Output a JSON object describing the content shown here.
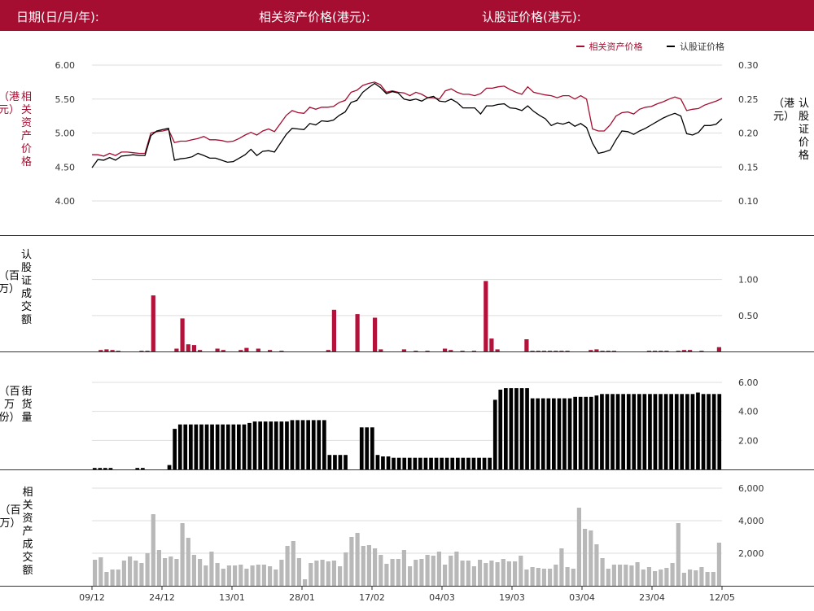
{
  "header": {
    "date_label": "日期(日/月/年):",
    "underlying_label": "相关资产价格(港元):",
    "warrant_label": "认股证价格(港元):"
  },
  "legend": {
    "underlying": "相关资产价格",
    "warrant": "认股证价格"
  },
  "axis_titles": {
    "price_left": "相关资产价格",
    "price_left_unit": "（港元）",
    "price_right": "认股证价格",
    "price_right_unit": "（港元）",
    "turnover": "认股证成交额",
    "turnover_unit": "（百万）",
    "outstanding": "街货量",
    "outstanding_unit": "（百万份）",
    "underlying_turnover": "相关资产成交额",
    "underlying_turnover_unit": "（百万）"
  },
  "colors": {
    "header_bg": "#a50d31",
    "underlying": "#a50d31",
    "warrant": "#000000",
    "turnover_bar": "#b5123b",
    "outstanding_bar": "#000000",
    "underlying_turnover_bar": "#b8b8b8"
  },
  "chart_data": [
    {
      "type": "line",
      "x_ticks": [
        "09/12",
        "24/12",
        "13/01",
        "28/01",
        "17/02",
        "04/03",
        "19/03",
        "03/04",
        "23/04",
        "12/05"
      ],
      "left_axis": {
        "ylim": [
          4.0,
          6.0
        ],
        "ticks": [
          "6.00",
          "5.50",
          "5.00",
          "4.50",
          "4.00"
        ]
      },
      "right_axis": {
        "ylim": [
          0.1,
          0.3
        ],
        "ticks": [
          "0.30",
          "0.25",
          "0.20",
          "0.15",
          "0.10"
        ]
      },
      "series": [
        {
          "name": "相关资产价格",
          "axis": "left",
          "values": [
            4.68,
            4.68,
            4.66,
            4.7,
            4.67,
            4.72,
            4.72,
            4.71,
            4.7,
            4.7,
            5.0,
            5.02,
            5.03,
            5.05,
            4.86,
            4.88,
            4.88,
            4.9,
            4.92,
            4.95,
            4.9,
            4.9,
            4.89,
            4.87,
            4.88,
            4.92,
            4.97,
            5.01,
            4.97,
            5.03,
            5.06,
            5.02,
            5.14,
            5.26,
            5.33,
            5.3,
            5.29,
            5.38,
            5.35,
            5.38,
            5.38,
            5.39,
            5.45,
            5.48,
            5.6,
            5.63,
            5.7,
            5.73,
            5.75,
            5.71,
            5.6,
            5.62,
            5.6,
            5.59,
            5.55,
            5.6,
            5.57,
            5.52,
            5.52,
            5.5,
            5.62,
            5.65,
            5.6,
            5.57,
            5.57,
            5.55,
            5.58,
            5.66,
            5.66,
            5.68,
            5.69,
            5.64,
            5.6,
            5.57,
            5.68,
            5.6,
            5.58,
            5.56,
            5.55,
            5.52,
            5.55,
            5.55,
            5.5,
            5.55,
            5.5,
            5.06,
            5.03,
            5.03,
            5.12,
            5.25,
            5.3,
            5.31,
            5.28,
            5.35,
            5.38,
            5.39,
            5.43,
            5.46,
            5.5,
            5.53,
            5.5,
            5.33,
            5.35,
            5.36,
            5.41,
            5.44,
            5.47,
            5.51
          ]
        },
        {
          "name": "认股证价格",
          "axis": "right",
          "values": [
            0.149,
            0.161,
            0.16,
            0.164,
            0.16,
            0.166,
            0.167,
            0.168,
            0.167,
            0.167,
            0.196,
            0.203,
            0.205,
            0.207,
            0.16,
            0.162,
            0.163,
            0.165,
            0.17,
            0.167,
            0.163,
            0.163,
            0.16,
            0.157,
            0.158,
            0.163,
            0.168,
            0.176,
            0.167,
            0.173,
            0.174,
            0.172,
            0.185,
            0.198,
            0.207,
            0.206,
            0.205,
            0.214,
            0.212,
            0.218,
            0.217,
            0.219,
            0.226,
            0.231,
            0.245,
            0.248,
            0.26,
            0.267,
            0.273,
            0.267,
            0.258,
            0.261,
            0.259,
            0.25,
            0.248,
            0.25,
            0.247,
            0.252,
            0.254,
            0.247,
            0.246,
            0.25,
            0.245,
            0.237,
            0.237,
            0.237,
            0.228,
            0.24,
            0.24,
            0.242,
            0.243,
            0.237,
            0.236,
            0.233,
            0.24,
            0.232,
            0.226,
            0.221,
            0.211,
            0.215,
            0.213,
            0.216,
            0.21,
            0.214,
            0.208,
            0.185,
            0.17,
            0.172,
            0.175,
            0.19,
            0.203,
            0.202,
            0.198,
            0.203,
            0.207,
            0.212,
            0.217,
            0.222,
            0.226,
            0.229,
            0.225,
            0.199,
            0.197,
            0.201,
            0.211,
            0.211,
            0.213,
            0.221
          ]
        }
      ]
    },
    {
      "type": "bar",
      "name": "认股证成交额",
      "ylim": [
        0,
        1.2
      ],
      "y_ticks": [
        "1.00",
        "0.50"
      ],
      "values": [
        0,
        0.02,
        0.03,
        0.02,
        0.01,
        0,
        0,
        0,
        0.01,
        0.01,
        0.78,
        0,
        0,
        0,
        0.04,
        0.46,
        0.1,
        0.09,
        0.02,
        0,
        0,
        0.04,
        0.02,
        0,
        0,
        0.02,
        0.05,
        0,
        0.04,
        0,
        0.02,
        0,
        0.01,
        0,
        0,
        0,
        0,
        0,
        0,
        0,
        0.02,
        0.58,
        0,
        0,
        0,
        0.52,
        0,
        0,
        0.47,
        0.03,
        0,
        0,
        0,
        0.03,
        0,
        0.01,
        0,
        0.01,
        0,
        0,
        0.04,
        0.02,
        0,
        0.01,
        0,
        0.01,
        0,
        0.98,
        0.18,
        0.03,
        0,
        0,
        0,
        0,
        0.17,
        0.01,
        0.01,
        0.01,
        0.01,
        0.01,
        0.01,
        0.01,
        0,
        0,
        0,
        0.02,
        0.03,
        0.01,
        0.01,
        0.01,
        0,
        0,
        0,
        0,
        0,
        0.01,
        0.01,
        0.01,
        0.01,
        0,
        0.01,
        0.02,
        0.02,
        0,
        0.01,
        0,
        0,
        0.06
      ]
    },
    {
      "type": "bar",
      "name": "街货量",
      "ylim": [
        0,
        6.0
      ],
      "y_ticks": [
        "6.00",
        "4.00",
        "2.00"
      ],
      "values": [
        0.1,
        0.1,
        0.1,
        0.1,
        0,
        0,
        0,
        0,
        0.1,
        0.1,
        0,
        0,
        0,
        0,
        0.3,
        2.8,
        3.1,
        3.1,
        3.1,
        3.1,
        3.1,
        3.1,
        3.1,
        3.1,
        3.1,
        3.1,
        3.1,
        3.1,
        3.1,
        3.2,
        3.3,
        3.3,
        3.3,
        3.3,
        3.3,
        3.3,
        3.3,
        3.4,
        3.4,
        3.4,
        3.4,
        3.4,
        3.4,
        3.4,
        1.0,
        1.0,
        1.0,
        1.0,
        0,
        0,
        2.9,
        2.9,
        2.9,
        1.0,
        0.9,
        0.9,
        0.8,
        0.8,
        0.8,
        0.8,
        0.8,
        0.8,
        0.8,
        0.8,
        0.8,
        0.8,
        0.8,
        0.8,
        0.8,
        0.8,
        0.8,
        0.8,
        0.8,
        0.8,
        0.8,
        4.8,
        5.5,
        5.6,
        5.6,
        5.6,
        5.6,
        5.6,
        4.9,
        4.9,
        4.9,
        4.9,
        4.9,
        4.9,
        4.9,
        4.9,
        5.0,
        5.0,
        5.0,
        5.0,
        5.1,
        5.2,
        5.2,
        5.2,
        5.2,
        5.2,
        5.2,
        5.2,
        5.2,
        5.2,
        5.2,
        5.2,
        5.2,
        5.2,
        5.2,
        5.2,
        5.2,
        5.2,
        5.2,
        5.3,
        5.2,
        5.2,
        5.2,
        5.2
      ]
    },
    {
      "type": "bar",
      "name": "相关资产成交额",
      "ylim": [
        0,
        7200
      ],
      "y_ticks": [
        "6,000",
        "4,000",
        "2,000"
      ],
      "values": [
        1600,
        1750,
        850,
        1000,
        1000,
        1550,
        1800,
        1550,
        1400,
        2000,
        4400,
        2200,
        1700,
        1800,
        1650,
        3850,
        2950,
        1900,
        1650,
        1250,
        2100,
        1400,
        1050,
        1250,
        1250,
        1300,
        1050,
        1250,
        1300,
        1300,
        1200,
        1000,
        1600,
        2450,
        2750,
        1700,
        400,
        1400,
        1550,
        1600,
        1500,
        1550,
        1200,
        2050,
        3000,
        3250,
        2450,
        2500,
        2300,
        1900,
        1350,
        1650,
        1650,
        2200,
        1200,
        1600,
        1650,
        1900,
        1850,
        2100,
        1300,
        1850,
        2100,
        1550,
        1550,
        1200,
        1600,
        1400,
        1550,
        1450,
        1650,
        1500,
        1500,
        1850,
        1000,
        1150,
        1100,
        1050,
        1050,
        1300,
        2300,
        1150,
        1050,
        4800,
        3500,
        3400,
        2550,
        1700,
        1050,
        1300,
        1300,
        1300,
        1250,
        1450,
        1000,
        1150,
        900,
        1000,
        1100,
        1400,
        3850,
        800,
        1000,
        950,
        1150,
        850,
        850,
        2650
      ]
    }
  ]
}
